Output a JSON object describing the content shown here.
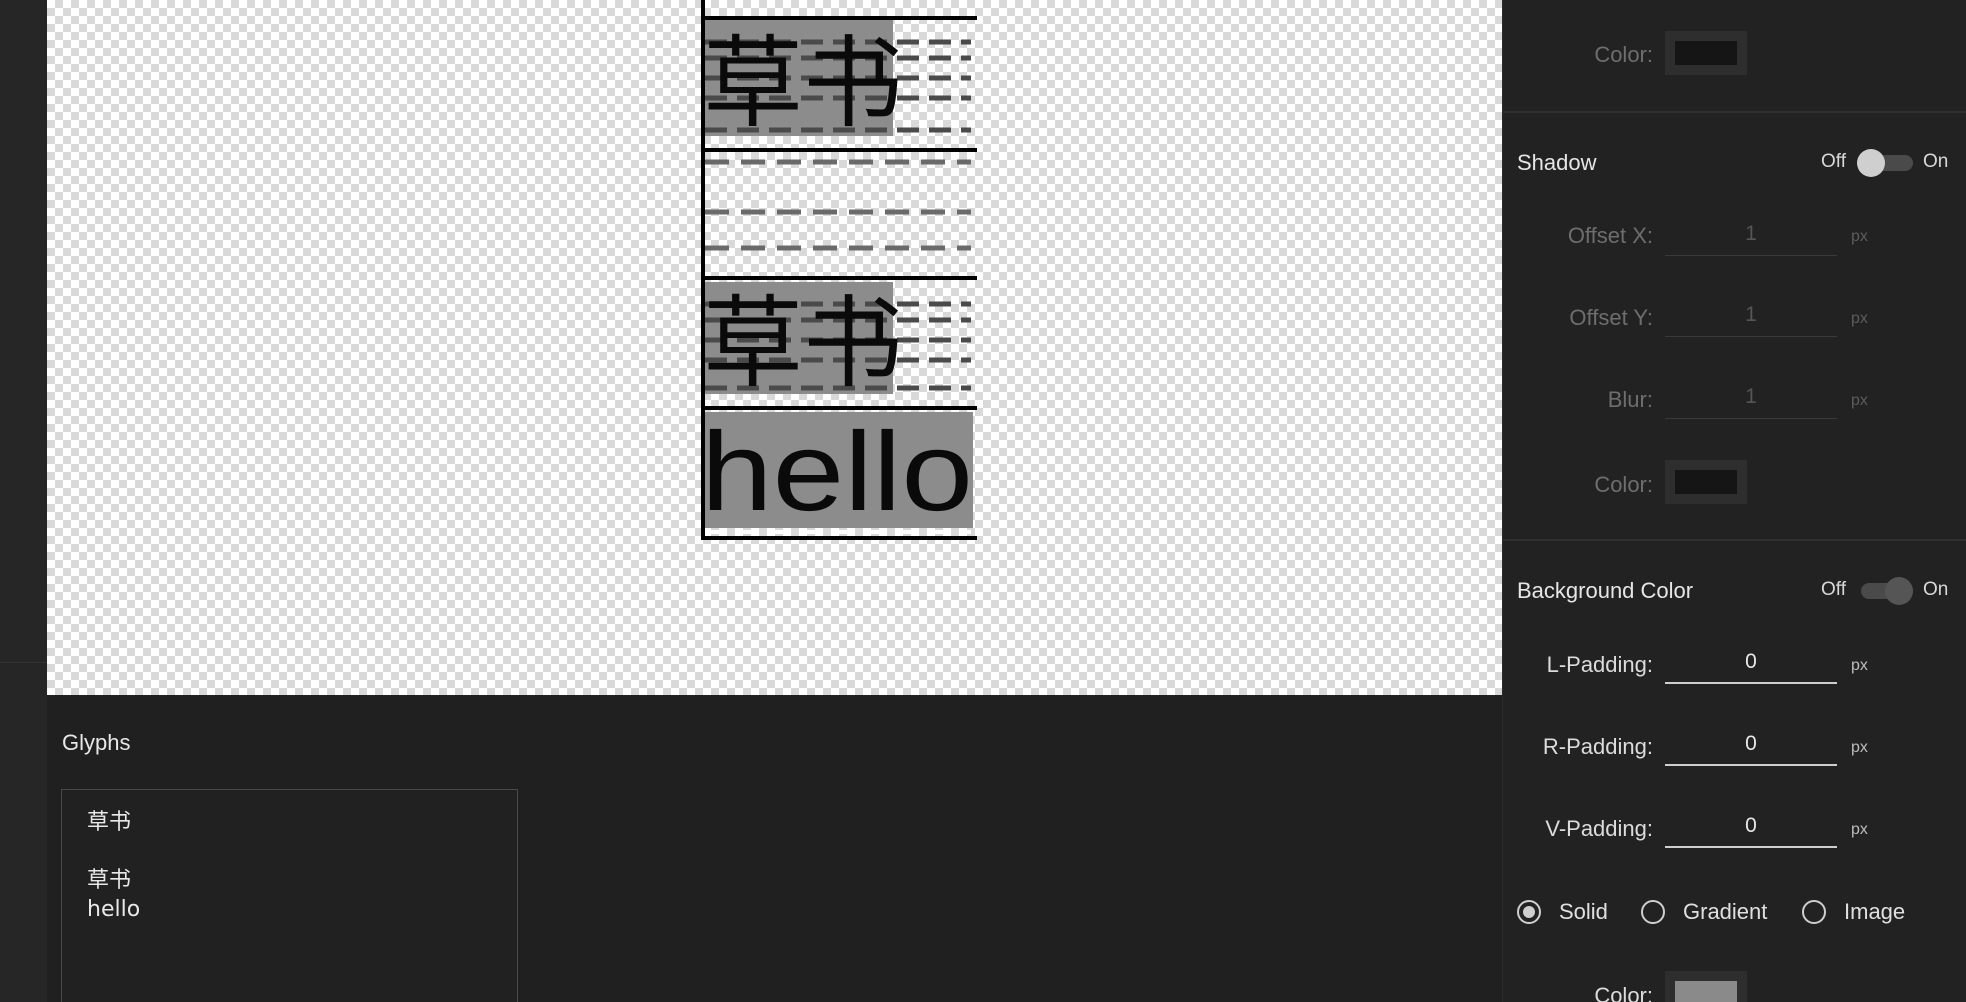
{
  "canvas": {
    "atlas_glyph_1": "草书",
    "atlas_glyph_2": "草书",
    "atlas_glyph_3": "hello"
  },
  "glyphs_panel": {
    "title": "Glyphs",
    "text": "草书\n\n草书\nhello"
  },
  "outline_section": {
    "color_label": "Color:",
    "color_value": "#1a1a1a"
  },
  "shadow_section": {
    "title": "Shadow",
    "toggle_off": "Off",
    "toggle_on": "On",
    "enabled": false,
    "offset_x_label": "Offset X:",
    "offset_x_value": "1",
    "offset_y_label": "Offset Y:",
    "offset_y_value": "1",
    "blur_label": "Blur:",
    "blur_value": "1",
    "unit": "px",
    "color_label": "Color:",
    "color_value": "#1a1a1a"
  },
  "background_section": {
    "title": "Background Color",
    "toggle_off": "Off",
    "toggle_on": "On",
    "enabled": true,
    "l_padding_label": "L-Padding:",
    "l_padding_value": "0",
    "r_padding_label": "R-Padding:",
    "r_padding_value": "0",
    "v_padding_label": "V-Padding:",
    "v_padding_value": "0",
    "unit": "px",
    "fill_options": [
      {
        "label": "Solid",
        "selected": true
      },
      {
        "label": "Gradient",
        "selected": false
      },
      {
        "label": "Image",
        "selected": false
      }
    ],
    "color_label": "Color:",
    "color_value": "#8a8a8a"
  }
}
